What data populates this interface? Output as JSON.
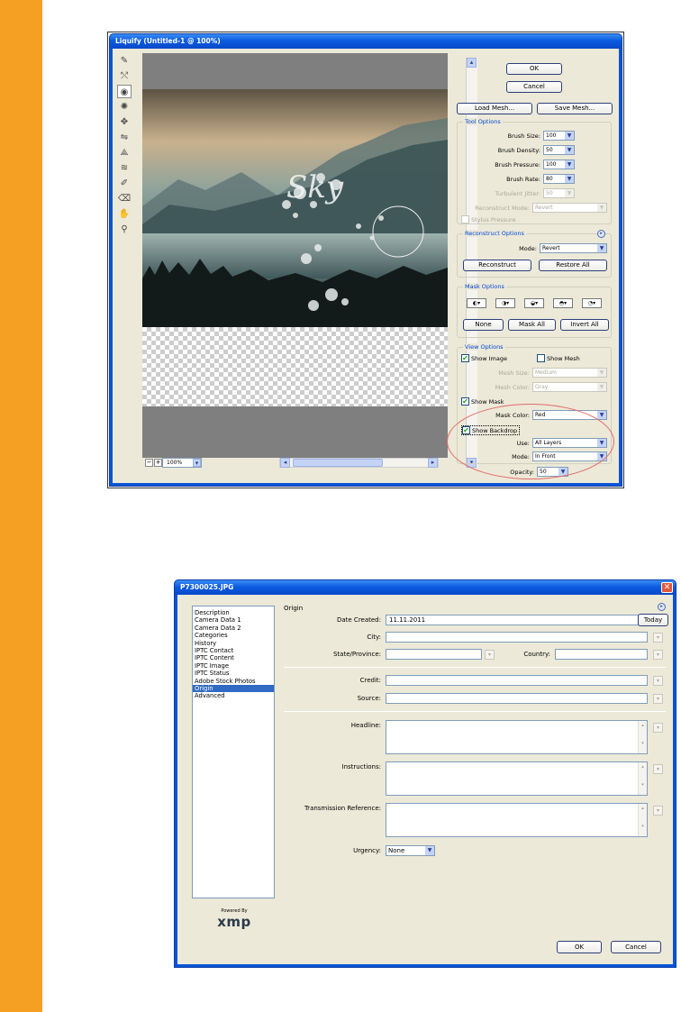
{
  "liquify": {
    "title": "Liquify (Untitled-1 @ 100%)",
    "ok_label": "OK",
    "cancel_label": "Cancel",
    "load_mesh_label": "Load Mesh...",
    "save_mesh_label": "Save Mesh...",
    "zoom_minus": "−",
    "zoom_plus": "+",
    "zoom_value": "100%",
    "tool_options": {
      "title": "Tool Options",
      "brush_size_label": "Brush Size:",
      "brush_size": "100",
      "brush_density_label": "Brush Density:",
      "brush_density": "50",
      "brush_pressure_label": "Brush Pressure:",
      "brush_pressure": "100",
      "brush_rate_label": "Brush Rate:",
      "brush_rate": "80",
      "turbulent_jitter_label": "Turbulent Jitter:",
      "turbulent_jitter": "50",
      "reconstruct_mode_label": "Reconstruct Mode:",
      "reconstruct_mode": "Revert",
      "stylus_pressure_label": "Stylus Pressure"
    },
    "reconstruct_options": {
      "title": "Reconstruct Options",
      "mode_label": "Mode:",
      "mode": "Revert",
      "reconstruct_label": "Reconstruct",
      "restore_all_label": "Restore All"
    },
    "mask_options": {
      "title": "Mask Options",
      "none_label": "None",
      "mask_all_label": "Mask All",
      "invert_all_label": "Invert All"
    },
    "view_options": {
      "title": "View Options",
      "show_image_label": "Show Image",
      "show_mesh_label": "Show Mesh",
      "mesh_size_label": "Mesh Size:",
      "mesh_size": "Medium",
      "mesh_color_label": "Mesh Color:",
      "mesh_color": "Gray",
      "show_mask_label": "Show Mask",
      "mask_color_label": "Mask Color:",
      "mask_color": "Red",
      "show_backdrop_label": "Show Backdrop",
      "use_label": "Use:",
      "use": "All Layers",
      "mode_label": "Mode:",
      "mode": "In Front",
      "opacity_label": "Opacity:",
      "opacity": "50"
    }
  },
  "file_info": {
    "title": "P7300025.JPG",
    "close_glyph": "✕",
    "categories": [
      "Description",
      "Camera Data 1",
      "Camera Data 2",
      "Categories",
      "History",
      "IPTC Contact",
      "IPTC Content",
      "IPTC Image",
      "IPTC Status",
      "Adobe Stock Photos",
      "Origin",
      "Advanced"
    ],
    "selected_category": "Origin",
    "section_heading": "Origin",
    "date_created_label": "Date Created:",
    "date_created": "11.11.2011",
    "today_label": "Today",
    "city_label": "City:",
    "state_label": "State/Province:",
    "country_label": "Country:",
    "credit_label": "Credit:",
    "source_label": "Source:",
    "headline_label": "Headline:",
    "instructions_label": "Instructions:",
    "transmission_label": "Transmission Reference:",
    "urgency_label": "Urgency:",
    "urgency": "None",
    "powered_by": "Powered By",
    "xmp_logo": "xmp",
    "ok_label": "OK",
    "cancel_label": "Cancel"
  },
  "colors": {
    "accent_orange": "#f5a023",
    "xp_blue": "#0a55d6",
    "annotation_red": "#e46a6a",
    "selection": "#316ac5"
  }
}
